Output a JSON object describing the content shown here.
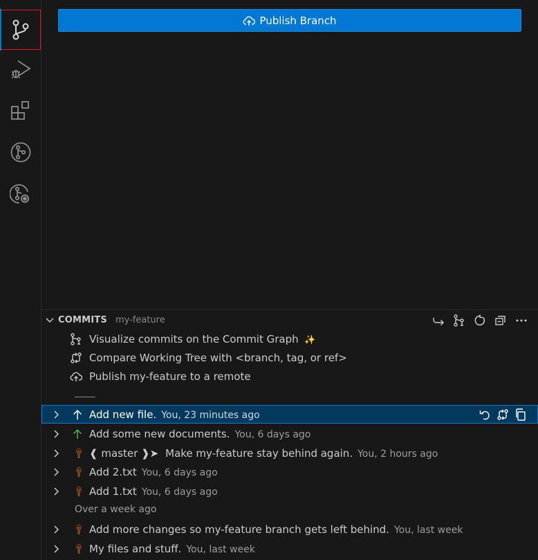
{
  "annotation": "1",
  "publish_label": "Publish Branch",
  "commits": {
    "title": "COMMITS",
    "branch": "my-feature",
    "actions": [
      {
        "name": "switch-icon"
      },
      {
        "name": "graph-icon"
      },
      {
        "name": "refresh-icon"
      },
      {
        "name": "collapse-all-icon"
      },
      {
        "name": "more-icon"
      }
    ],
    "actions_rows": [
      {
        "label": "Visualize commits on the Commit Graph",
        "suffix": "✨",
        "icon": "commit-graph-icon"
      },
      {
        "label": "Compare Working Tree with <branch, tag, or ref>",
        "icon": "compare-icon"
      },
      {
        "label": "Publish my-feature to a remote",
        "icon": "cloud-upload-icon"
      }
    ],
    "items": [
      {
        "message": "Add new file.",
        "meta": "You, 23 minutes ago",
        "icon": "arrow-up-icon",
        "selected": true
      },
      {
        "message": "Add some new documents.",
        "meta": "You, 6 days ago",
        "icon": "arrow-up-green-icon"
      },
      {
        "tag": "❰ master ❱➤",
        "message": "Make my-feature stay behind again.",
        "meta": "You, 2 hours ago",
        "icon": "avatar-icon"
      },
      {
        "message": "Add 2.txt",
        "meta": "You, 6 days ago",
        "icon": "avatar-icon"
      },
      {
        "message": "Add 1.txt",
        "meta": "You, 6 days ago",
        "icon": "avatar-icon"
      }
    ],
    "group_label": "Over a week ago",
    "older_items": [
      {
        "message": "Add more changes so my-feature branch gets left behind.",
        "meta": "You, last week",
        "icon": "avatar-icon"
      },
      {
        "message": "My files and stuff.",
        "meta": "You, last week",
        "icon": "avatar-icon"
      }
    ]
  },
  "colors": {
    "accent": "#0078d4",
    "annotation": "#e81123",
    "selection": "#04395e",
    "green_arrow": "#3fb950"
  }
}
